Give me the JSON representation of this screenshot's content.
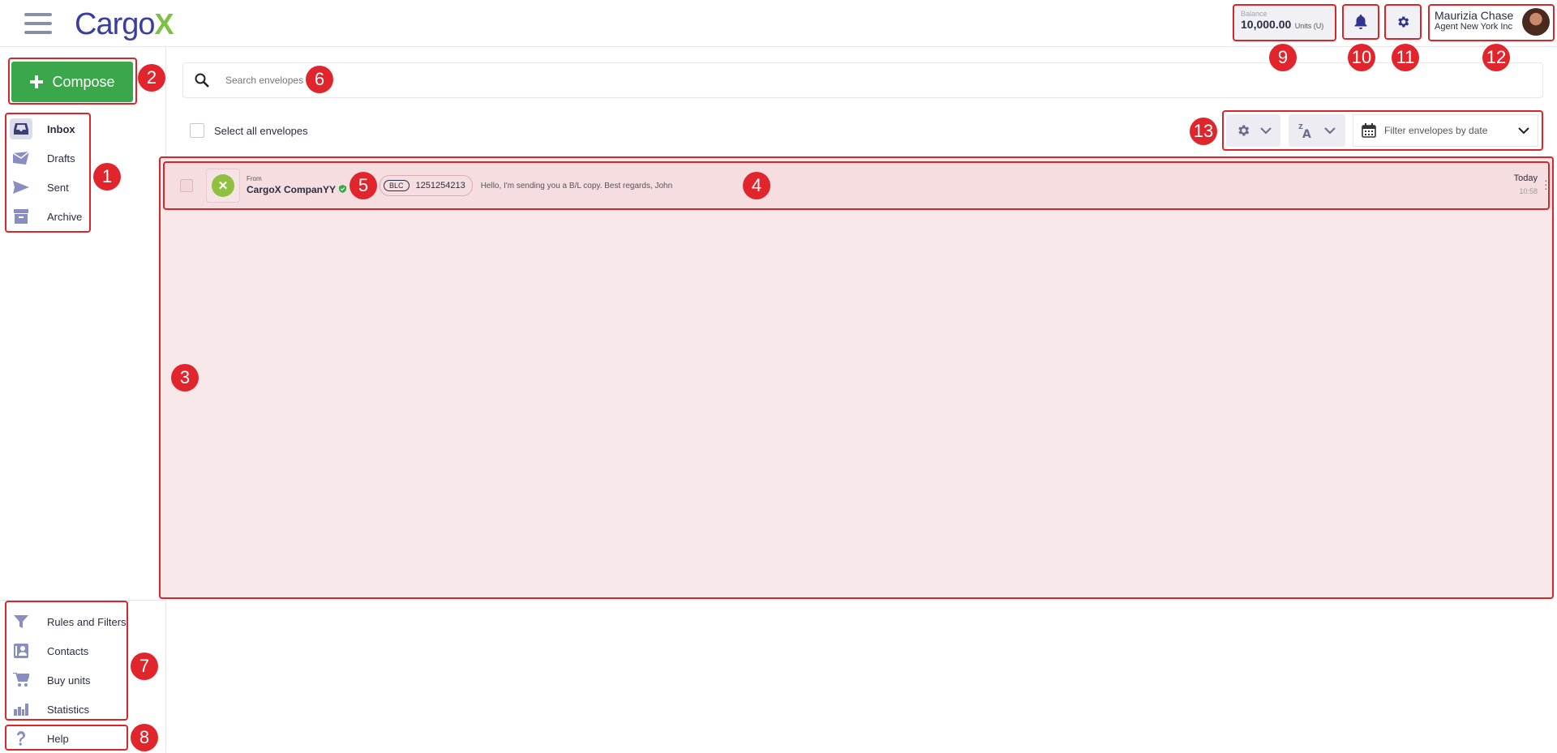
{
  "header": {
    "logo_text": "Cargo",
    "logo_x": "X",
    "balance_label": "Balance",
    "balance_value": "10,000.00",
    "balance_unit": "Units (U)",
    "user_name": "Maurizia Chase",
    "user_org": "Agent New York Inc"
  },
  "sidebar": {
    "compose_label": "Compose",
    "nav": [
      {
        "label": "Inbox",
        "icon": "inbox-icon"
      },
      {
        "label": "Drafts",
        "icon": "drafts-icon"
      },
      {
        "label": "Sent",
        "icon": "sent-icon"
      },
      {
        "label": "Archive",
        "icon": "archive-icon"
      }
    ],
    "tools": [
      {
        "label": "Rules and Filters",
        "icon": "filter-icon"
      },
      {
        "label": "Contacts",
        "icon": "contacts-icon"
      },
      {
        "label": "Buy units",
        "icon": "cart-icon"
      },
      {
        "label": "Statistics",
        "icon": "bar-chart-icon"
      }
    ],
    "help_label": "Help"
  },
  "main": {
    "search_placeholder": "Search envelopes",
    "select_all_label": "Select all envelopes",
    "date_filter_placeholder": "Filter envelopes by date",
    "envelopes": [
      {
        "from_label": "From",
        "sender": "CargoX CompanYY",
        "doc_type": "BLC",
        "doc_number": "1251254213",
        "message": "Hello, I'm sending you a B/L copy. Best regards, John",
        "date": "Today",
        "time": "10:58"
      }
    ]
  },
  "callouts": [
    "1",
    "2",
    "3",
    "4",
    "5",
    "6",
    "7",
    "8",
    "9",
    "10",
    "11",
    "12",
    "13"
  ],
  "colors": {
    "compose_green": "#3aa84a",
    "brand_blue": "#3a3f9e",
    "highlight_red": "#e0262c",
    "row_pink": "#f6dde0"
  }
}
